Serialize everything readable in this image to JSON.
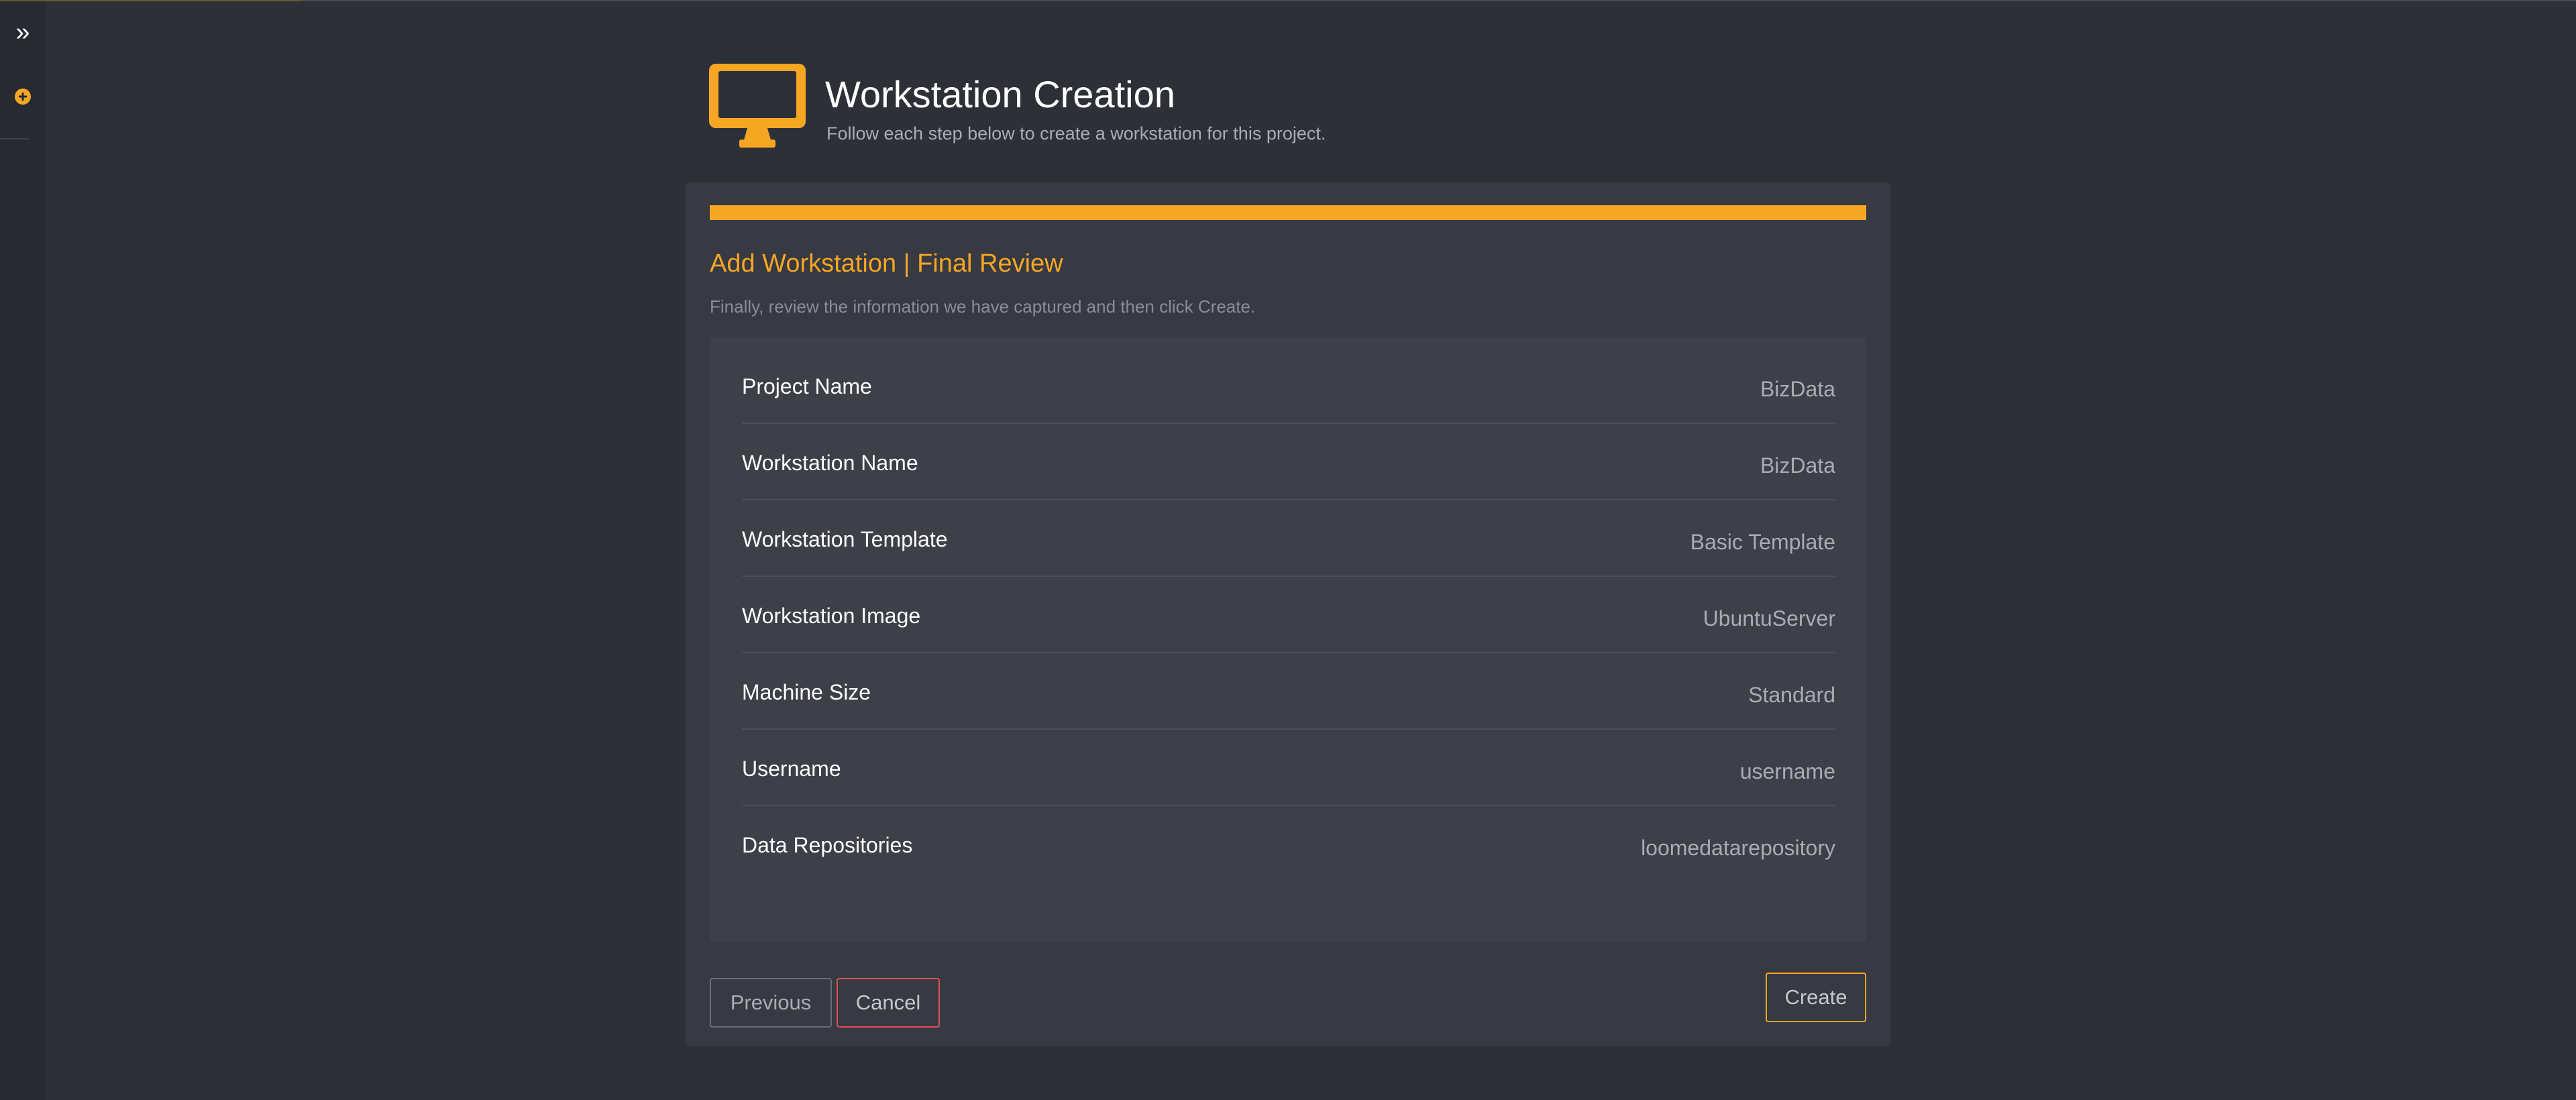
{
  "colors": {
    "accent": "#f5a623",
    "background": "#2e3038",
    "panel": "#373943",
    "cancel_border": "#d9534f"
  },
  "sidebar": {
    "expand_icon": "double-chevron-right-icon",
    "add_icon": "plus-circle-icon"
  },
  "header": {
    "icon": "monitor-icon",
    "title": "Workstation Creation",
    "subtitle": "Follow each step below to create a workstation for this project."
  },
  "wizard": {
    "progress_percent": 100,
    "step_title": "Add Workstation | Final Review",
    "step_description": "Finally, review the information we have captured and then click Create.",
    "review_rows": [
      {
        "label": "Project Name",
        "value": "BizData"
      },
      {
        "label": "Workstation Name",
        "value": "BizData"
      },
      {
        "label": "Workstation Template",
        "value": "Basic Template"
      },
      {
        "label": "Workstation Image",
        "value": "UbuntuServer"
      },
      {
        "label": "Machine Size",
        "value": "Standard"
      },
      {
        "label": "Username",
        "value": "username"
      },
      {
        "label": "Data Repositories",
        "value": "loomedatarepository"
      }
    ],
    "buttons": {
      "previous": "Previous",
      "cancel": "Cancel",
      "create": "Create"
    }
  }
}
